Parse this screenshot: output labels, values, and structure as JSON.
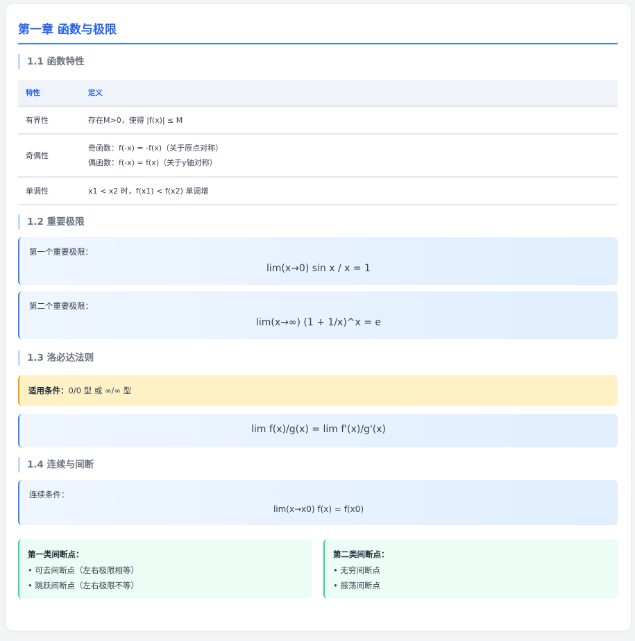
{
  "chapter": {
    "title": "第一章 函数与极限"
  },
  "sections": {
    "s1": "1.1 函数特性",
    "s2": "1.2 重要极限",
    "s3": "1.3 洛必达法则",
    "s4": "1.4 连续与间断"
  },
  "table": {
    "headers": [
      "特性",
      "定义"
    ],
    "rows": [
      {
        "name": "有界性",
        "defs": [
          "存在M>0，使得 |f(x)| ≤ M"
        ]
      },
      {
        "name": "奇偶性",
        "defs": [
          "奇函数：f(-x) = -f(x)（关于原点对称）",
          "偶函数：f(-x) = f(x)（关于y轴对称）"
        ]
      },
      {
        "name": "单调性",
        "defs": [
          "x1 < x2 时，f(x1) < f(x2) 单调增"
        ]
      }
    ]
  },
  "limits": {
    "first_label": "第一个重要极限：",
    "first_formula": "lim(x→0) sin x / x = 1",
    "second_label": "第二个重要极限：",
    "second_formula": "lim(x→∞) (1 + 1/x)^x = e"
  },
  "lhopital": {
    "condition_label": "适用条件：",
    "condition_text": "0/0 型 或 ∞/∞ 型",
    "formula": "lim f(x)/g(x) = lim f'(x)/g'(x)"
  },
  "continuity": {
    "label": "连续条件：",
    "formula": "lim(x→x0) f(x) = f(x0)",
    "first_kind": {
      "title": "第一类间断点：",
      "items": [
        "• 可去间断点（左右极限相等）",
        "• 跳跃间断点（左右极限不等）"
      ]
    },
    "second_kind": {
      "title": "第二类间断点：",
      "items": [
        "• 无穷间断点",
        "• 振荡间断点"
      ]
    }
  },
  "colors": {
    "accent": "#2563eb",
    "warning": "#f59e0b",
    "success": "#34d399"
  }
}
